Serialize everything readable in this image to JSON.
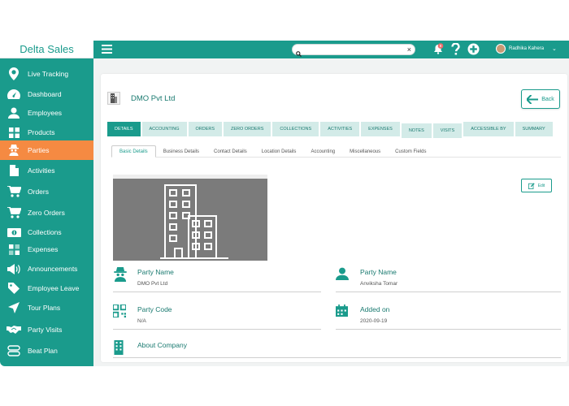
{
  "brand": {
    "name": "Delta Sales"
  },
  "sidebar": {
    "items": [
      {
        "label": "Live Tracking",
        "icon": "map-pin-icon"
      },
      {
        "label": "Dashboard",
        "icon": "speedometer-icon"
      },
      {
        "label": "Employees",
        "icon": "user-icon"
      },
      {
        "label": "Products",
        "icon": "grid-icon"
      },
      {
        "label": "Parties",
        "icon": "spy-icon"
      },
      {
        "label": "Activities",
        "icon": "document-icon"
      },
      {
        "label": "Orders",
        "icon": "cart-icon"
      },
      {
        "label": "Zero Orders",
        "icon": "cart-icon"
      },
      {
        "label": "Collections",
        "icon": "money-icon"
      },
      {
        "label": "Expenses",
        "icon": "grid-icon"
      },
      {
        "label": "Announcements",
        "icon": "megaphone-icon"
      },
      {
        "label": "Employee Leave",
        "icon": "tag-icon"
      },
      {
        "label": "Tour Plans",
        "icon": "send-icon"
      },
      {
        "label": "Party Visits",
        "icon": "handshake-icon"
      },
      {
        "label": "Beat Plan",
        "icon": "stack-icon"
      }
    ],
    "active_label": "Parties"
  },
  "topbar": {
    "search_value": "",
    "search_placeholder": "",
    "notification_count": "8",
    "user_name": "Radhika Kahera"
  },
  "page": {
    "title": "DMO Pvt Ltd",
    "back_label": "Back",
    "edit_label": "Edit"
  },
  "tabs": [
    "DETAILS",
    "ACCOUNTING",
    "ORDERS",
    "ZERO ORDERS",
    "COLLECTIONS",
    "ACTIVITIES",
    "EXPENSES",
    "NOTES",
    "VISITS",
    "ACCESSIBLE BY",
    "SUMMARY"
  ],
  "subtabs": [
    "Basic Details",
    "Business Details",
    "Contact Details",
    "Location Details",
    "Accounting",
    "Miscellaneous",
    "Custom Fields"
  ],
  "fields": {
    "party_name": {
      "label": "Party Name",
      "value": "DMO Pvt Ltd"
    },
    "owner_name": {
      "label": "Party Name",
      "value": "Anviksha Tomar"
    },
    "party_code": {
      "label": "Party Code",
      "value": "N/A"
    },
    "added_on": {
      "label": "Added on",
      "value": "2020-09-19"
    },
    "about": {
      "label": "About Company",
      "value": ""
    }
  },
  "colors": {
    "primary": "#1a9b8c",
    "active": "#f58a42"
  }
}
